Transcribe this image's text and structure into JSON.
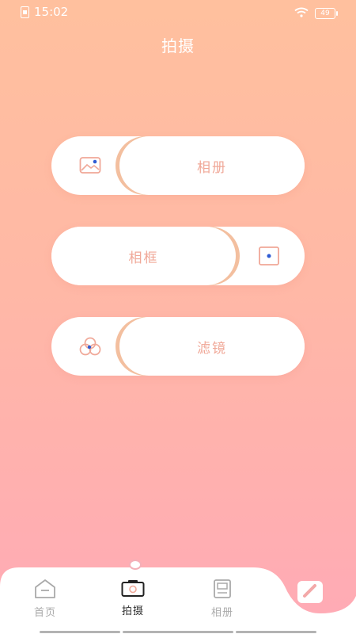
{
  "status_bar": {
    "time": "15:02",
    "battery": "49"
  },
  "page": {
    "title": "拍摄"
  },
  "options": [
    {
      "label": "相册",
      "icon": "image-icon"
    },
    {
      "label": "相框",
      "icon": "frame-icon"
    },
    {
      "label": "滤镜",
      "icon": "filter-icon"
    }
  ],
  "bottom_nav": {
    "items": [
      {
        "label": "首页",
        "icon": "home-icon",
        "active": false
      },
      {
        "label": "拍摄",
        "icon": "camera-icon",
        "active": true
      },
      {
        "label": "相册",
        "icon": "album-icon",
        "active": false
      }
    ],
    "edit_icon": "edit-icon"
  },
  "colors": {
    "accent": "#f0a898",
    "gradient_top": "#ffc09e",
    "gradient_bottom": "#ffaab6",
    "dot_blue": "#2f5bd3"
  }
}
